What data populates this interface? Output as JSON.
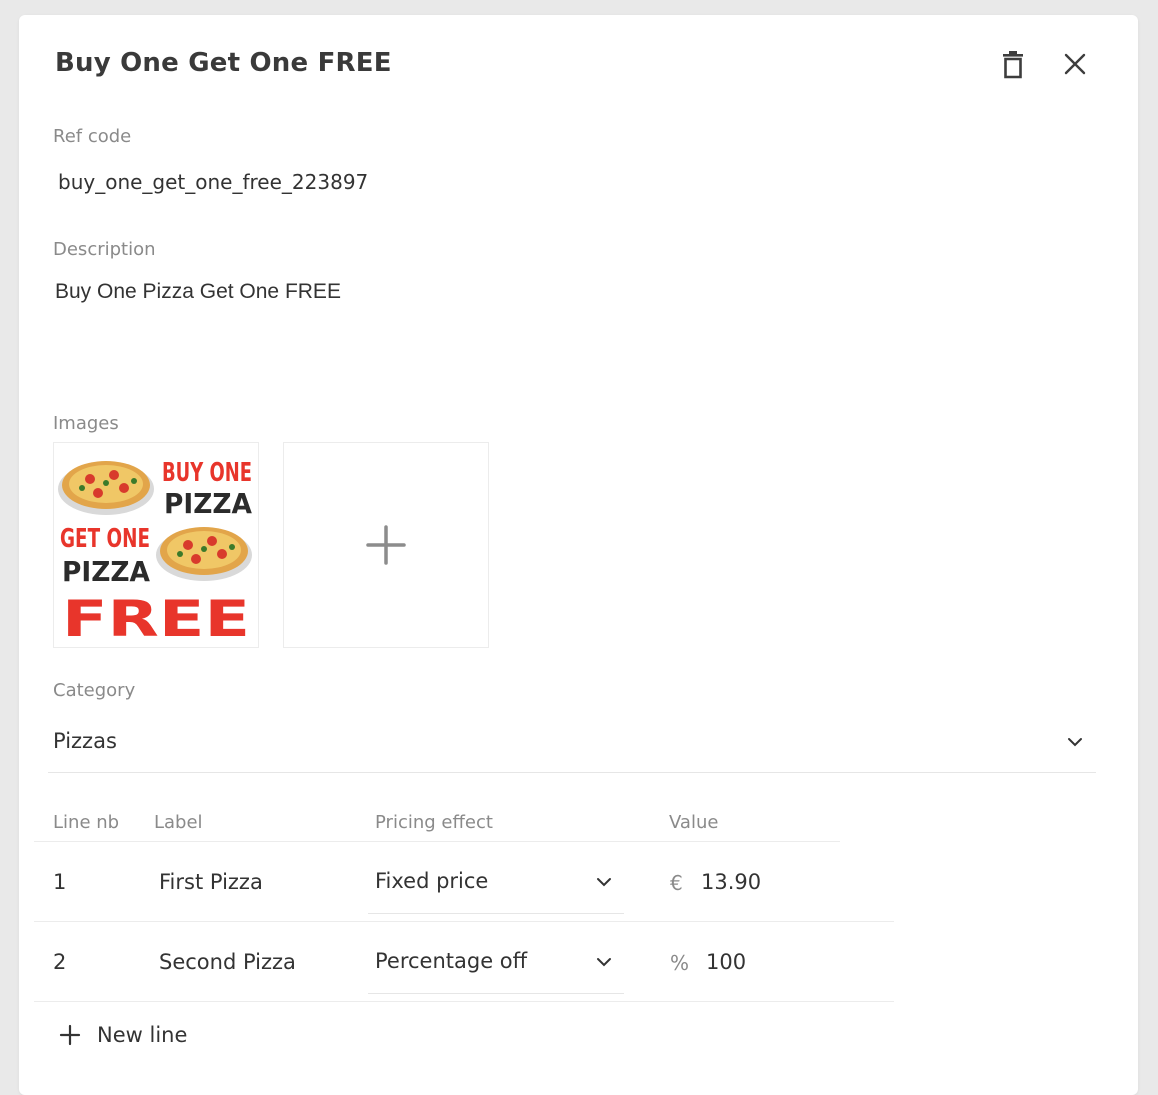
{
  "dialog": {
    "title": "Buy One Get One FREE",
    "delete_icon": "trash-icon",
    "close_icon": "close-icon"
  },
  "fields": {
    "ref_code": {
      "label": "Ref code",
      "value": "buy_one_get_one_free_223897"
    },
    "description": {
      "label": "Description",
      "value": "Buy One Pizza Get One FREE"
    },
    "images": {
      "label": "Images",
      "items": [
        {
          "lines": [
            "BUY ONE",
            "PIZZA",
            "GET ONE",
            "PIZZA",
            "FREE"
          ]
        }
      ],
      "add_icon": "plus-icon"
    },
    "category": {
      "label": "Category",
      "value": "Pizzas"
    }
  },
  "lines_table": {
    "headers": {
      "line_nb": "Line nb",
      "label": "Label",
      "pricing_effect": "Pricing effect",
      "value": "Value"
    },
    "rows": [
      {
        "line_nb": "1",
        "label": "First Pizza",
        "pricing_effect": "Fixed price",
        "unit": "€",
        "value": "13.90"
      },
      {
        "line_nb": "2",
        "label": "Second Pizza",
        "pricing_effect": "Percentage off",
        "unit": "%",
        "value": "100"
      }
    ],
    "new_line_label": "New line"
  },
  "colors": {
    "background": "#e9e9e9",
    "promo_red": "#e8352b",
    "promo_dark": "#2b2b2b"
  }
}
